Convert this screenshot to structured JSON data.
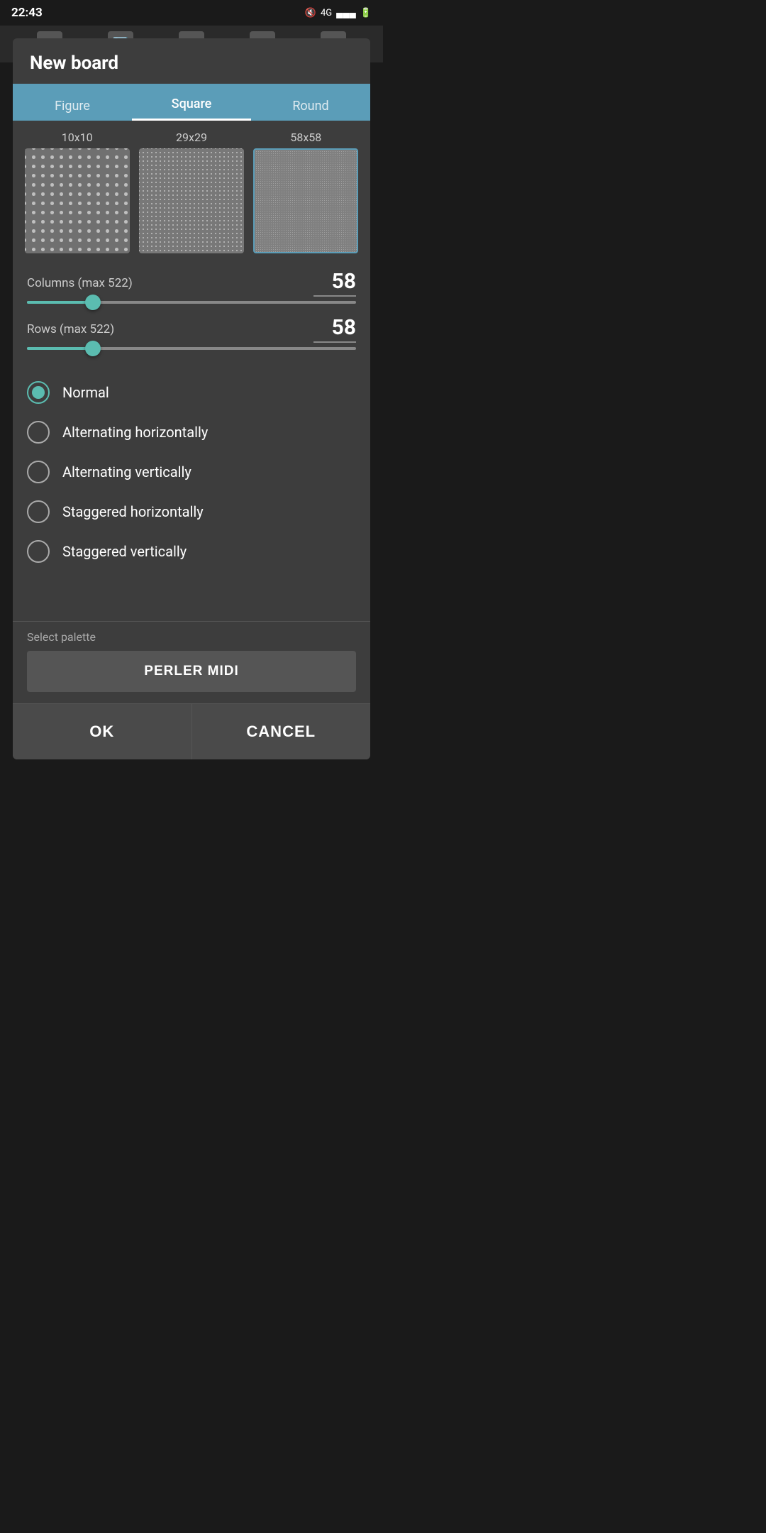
{
  "statusBar": {
    "time": "22:43",
    "icons": [
      "mute",
      "4g",
      "signal",
      "battery"
    ]
  },
  "dialog": {
    "title": "New board",
    "tabs": [
      {
        "id": "figure",
        "label": "Figure",
        "active": false
      },
      {
        "id": "square",
        "label": "Square",
        "active": true
      },
      {
        "id": "round",
        "label": "Round",
        "active": false
      }
    ],
    "gridSizes": [
      {
        "label": "10x10",
        "size": "small-grid",
        "dotClass": "dots-large"
      },
      {
        "label": "29x29",
        "size": "medium-grid",
        "dotClass": "dots-medium"
      },
      {
        "label": "58x58",
        "size": "large-grid",
        "dotClass": "dots-small"
      }
    ],
    "columnsLabel": "Columns (max 522)",
    "columnsValue": "58",
    "columnsPercent": 20,
    "rowsLabel": "Rows (max 522)",
    "rowsValue": "58",
    "rowsPercent": 20,
    "radioOptions": [
      {
        "id": "normal",
        "label": "Normal",
        "selected": true
      },
      {
        "id": "alt-h",
        "label": "Alternating horizontally",
        "selected": false
      },
      {
        "id": "alt-v",
        "label": "Alternating vertically",
        "selected": false
      },
      {
        "id": "stag-h",
        "label": "Staggered horizontally",
        "selected": false
      },
      {
        "id": "stag-v",
        "label": "Staggered vertically",
        "selected": false
      }
    ],
    "selectPaletteLabel": "Select palette",
    "paletteButtonLabel": "PERLER MIDI",
    "okLabel": "OK",
    "cancelLabel": "CANCEL"
  },
  "accentColor": "#5bbcb0",
  "tabActiveColor": "#5b9db8"
}
